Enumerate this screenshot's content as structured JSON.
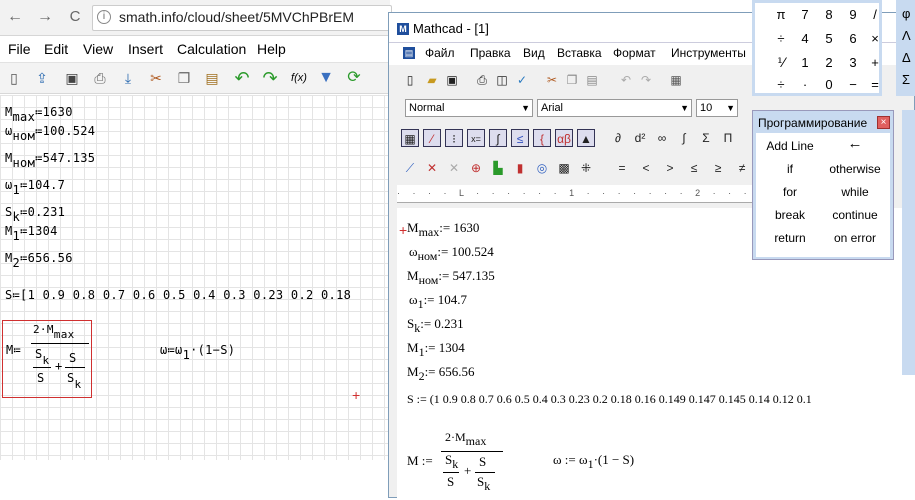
{
  "browser": {
    "url": "smath.info/cloud/sheet/5MVChPBrEM",
    "info_icon": "i",
    "back": "←",
    "forward": "→",
    "reload": "C"
  },
  "smath": {
    "menu": [
      "File",
      "Edit",
      "View",
      "Insert",
      "Calculation",
      "Help"
    ],
    "toolbar": [
      "new-icon",
      "upload-icon",
      "save-icon",
      "print-icon",
      "download-icon",
      "cut-icon",
      "copy-icon",
      "paste-icon",
      "undo-icon",
      "redo-icon",
      "function-icon",
      "filter-icon",
      "refresh-icon"
    ],
    "toolbar_fx": "f(x)",
    "lines": {
      "mmax": {
        "base": "M",
        "sub": "max",
        "rhs": "≔1630"
      },
      "wnom": {
        "base": "ω",
        "sub": "ном",
        "rhs": "≔100.524"
      },
      "mnom": {
        "base": "M",
        "sub": "ном",
        "rhs": "≔547.135"
      },
      "w1": {
        "base": "ω",
        "sub": "1",
        "rhs": "≔104.7"
      },
      "sk": {
        "base": "S",
        "sub": "k",
        "rhs": "≔0.231"
      },
      "m1": {
        "base": "M",
        "sub": "1",
        "rhs": "≔1304"
      },
      "m2": {
        "base": "M",
        "sub": "2",
        "rhs": "≔656.56"
      },
      "s": "S≔[1  0.9  0.8  0.7  0.6  0.5  0.4  0.3  0.23  0.2  0.18"
    },
    "formula": {
      "lhs": "M≔",
      "num": "2·M",
      "num_sub": "max",
      "s": "S",
      "sk": "S",
      "k": "k",
      "plus": "+"
    },
    "omega": {
      "text": "ω≔ω",
      "sub": "1",
      "rest": "·(1−S)"
    },
    "cursor": "+"
  },
  "mathcad": {
    "title": "Mathcad - [1]",
    "menu": [
      "Файл",
      "Правка",
      "Вид",
      "Вставка",
      "Формат",
      "Инструменты"
    ],
    "style": "Normal",
    "font": "Arial",
    "size": "10",
    "doc": {
      "mmax": {
        "base": "M",
        "sub": "max",
        "rhs": ":= 1630"
      },
      "wnom": {
        "base": "ω",
        "sub": "ном",
        "rhs": ":= 100.524"
      },
      "mnom": {
        "base": "M",
        "sub": "ном",
        "rhs": ":= 547.135"
      },
      "w1": {
        "base": "ω",
        "sub": "1",
        "rhs": ":= 104.7"
      },
      "sk": {
        "base": "S",
        "sub": "k",
        "rhs": ":= 0.231"
      },
      "m1": {
        "base": "M",
        "sub": "1",
        "rhs": ":= 1304"
      },
      "m2": {
        "base": "M",
        "sub": "2",
        "rhs": ":= 656.56"
      },
      "s": "S := (1   0.9   0.8   0.7   0.6   0.5   0.4   0.3   0.23   0.2   0.18   0.16   0.149   0.147   0.145   0.14   0.12   0.1",
      "formula": {
        "lhs": "M :=",
        "num": "2·M",
        "num_sub": "max",
        "s": "S",
        "sk": "S",
        "k": "k",
        "plus": "+"
      },
      "omega": {
        "text": "ω := ω",
        "sub": "1",
        "rest": "·(1 − S)"
      }
    }
  },
  "calculator": {
    "rows": [
      [
        "π",
        "7",
        "8",
        "9",
        "/"
      ],
      [
        "÷",
        "4",
        "5",
        "6",
        "×"
      ],
      [
        "⅟",
        "1",
        "2",
        "3",
        "+"
      ],
      [
        "÷",
        "·",
        "0",
        "−",
        "="
      ]
    ]
  },
  "programming": {
    "title": "Программирование",
    "buttons": [
      [
        "Add Line",
        "←"
      ],
      [
        "if",
        "otherwise"
      ],
      [
        "for",
        "while"
      ],
      [
        "break",
        "continue"
      ],
      [
        "return",
        "on error"
      ]
    ]
  },
  "right_panel": {
    "symbols": [
      "φ",
      "Λ",
      "Δ",
      "Σ"
    ]
  }
}
